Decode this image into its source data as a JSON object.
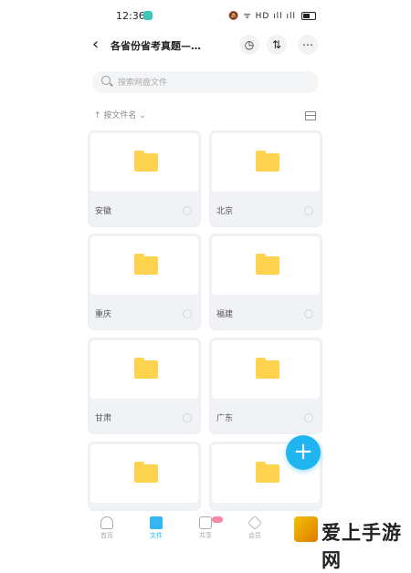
{
  "status_bar": {
    "time": "12:36",
    "icons_text": "🔕 ᯤ HD ıll ıll"
  },
  "header": {
    "title": "各省份省考真题—…"
  },
  "search": {
    "placeholder": "搜索网盘文件"
  },
  "sort": {
    "label": "↑ 按文件名 ⌄"
  },
  "folders": [
    {
      "name": "安徽"
    },
    {
      "name": "北京"
    },
    {
      "name": "重庆"
    },
    {
      "name": "福建"
    },
    {
      "name": "甘肃"
    },
    {
      "name": "广东"
    },
    {
      "name": ""
    },
    {
      "name": ""
    }
  ],
  "fab": {
    "symbol": "+"
  },
  "tabs": [
    {
      "label": "首页"
    },
    {
      "label": "文件"
    },
    {
      "label": "共享"
    },
    {
      "label": "会员"
    },
    {
      "label": "我的"
    }
  ],
  "watermark": {
    "text": "爱上手游网"
  },
  "colors": {
    "accent": "#1fb5f0",
    "folder": "#ffd34d"
  }
}
